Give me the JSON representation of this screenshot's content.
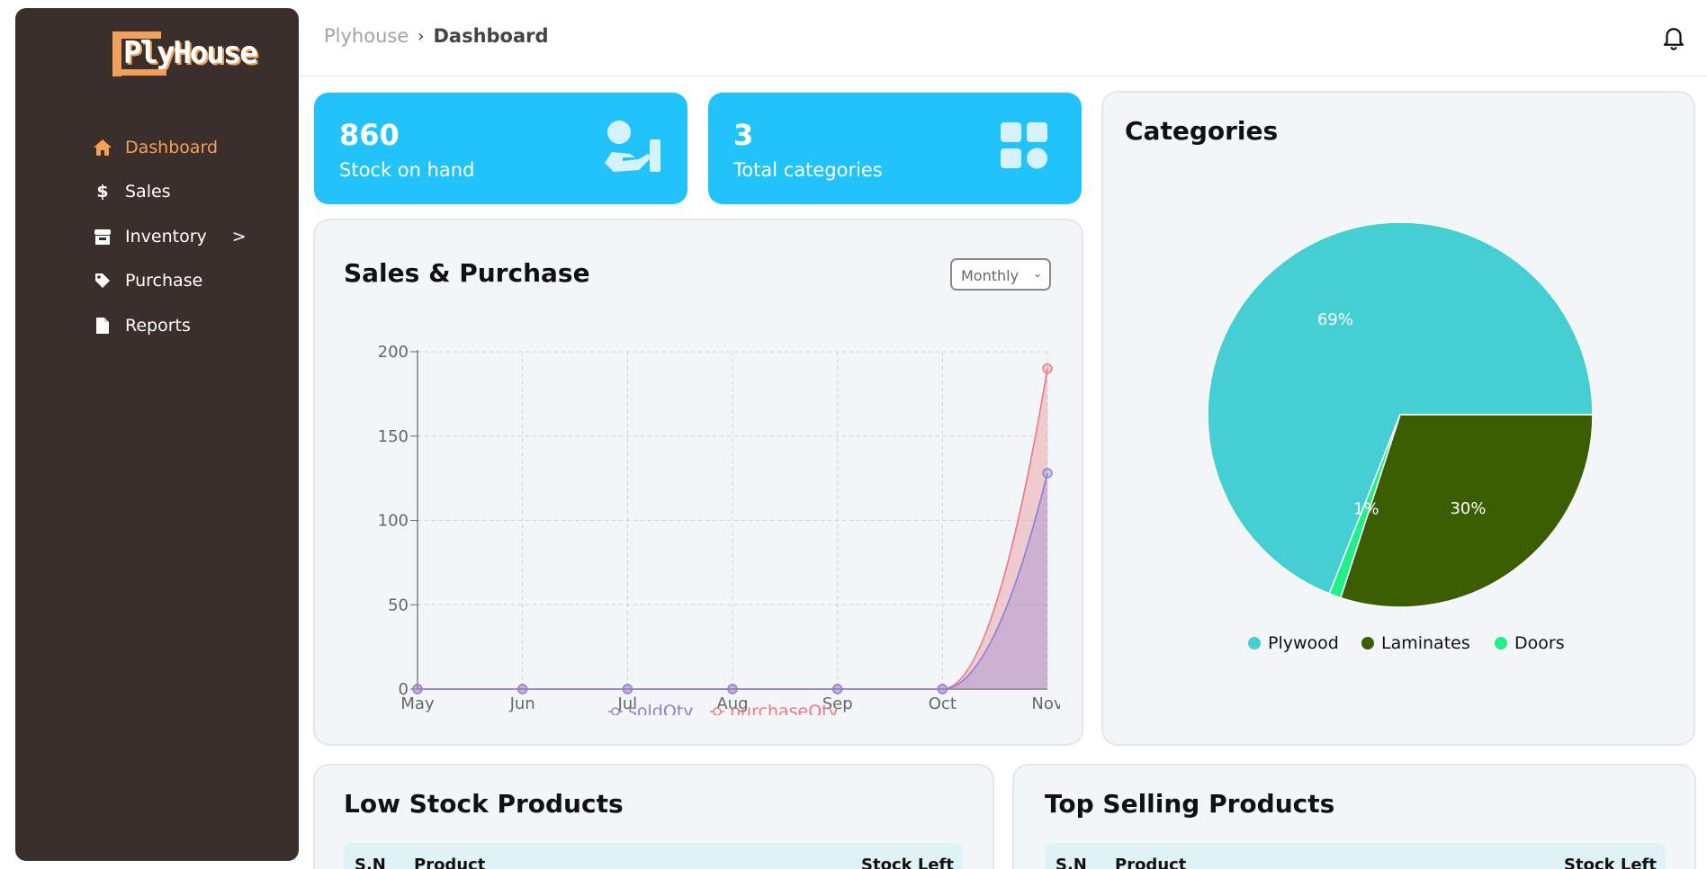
{
  "app": {
    "logo_text": "PlyHouse"
  },
  "sidebar": {
    "items": [
      {
        "label": "Dashboard",
        "icon": "home-icon",
        "active": true
      },
      {
        "label": "Sales",
        "icon": "dollar-icon",
        "active": false
      },
      {
        "label": "Inventory",
        "icon": "store-icon",
        "active": false,
        "arrow": ">"
      },
      {
        "label": "Purchase",
        "icon": "tag-icon",
        "active": false
      },
      {
        "label": "Reports",
        "icon": "file-icon",
        "active": false
      }
    ]
  },
  "header": {
    "breadcrumb_root": "Plyhouse",
    "breadcrumb_sep": "›",
    "breadcrumb_current": "Dashboard"
  },
  "stats": [
    {
      "value": "860",
      "label": "Stock on hand",
      "icon": "stock-hand-icon"
    },
    {
      "value": "3",
      "label": "Total categories",
      "icon": "categories-grid-icon"
    }
  ],
  "sales_panel": {
    "title": "Sales & Purchase",
    "period_select": "Monthly"
  },
  "categories_panel": {
    "title": "Categories"
  },
  "low_stock": {
    "title": "Low Stock Products",
    "columns": [
      "S.N",
      "Product",
      "Stock Left"
    ]
  },
  "top_selling": {
    "title": "Top Selling Products",
    "columns": [
      "S.N",
      "Product",
      "Stock Left"
    ]
  },
  "colors": {
    "sidebar_bg": "#3a2f2d",
    "accent": "#f5a05a",
    "stat_card": "#22c2fb",
    "sold": "#8b80d4",
    "purchase": "#ea7a83",
    "plywood": "#45cfd2",
    "laminates": "#3b5e03",
    "doors": "#22ee8a"
  },
  "chart_data": [
    {
      "type": "area",
      "categories": [
        "May",
        "Jun",
        "Jul",
        "Aug",
        "Sep",
        "Oct",
        "Nov"
      ],
      "series": [
        {
          "name": "soldQty",
          "values": [
            0,
            0,
            0,
            0,
            0,
            0,
            128
          ]
        },
        {
          "name": "purchaseQty",
          "values": [
            0,
            0,
            0,
            0,
            0,
            0,
            190
          ]
        }
      ],
      "ylim": [
        0,
        200
      ],
      "yticks": [
        0,
        50,
        100,
        150,
        200
      ],
      "grid": true,
      "legend": "bottom"
    },
    {
      "type": "pie",
      "labels": [
        "Plywood",
        "Laminates",
        "Doors"
      ],
      "values": [
        69,
        30,
        1
      ],
      "data_labels": [
        "69%",
        "30%",
        "1%"
      ],
      "legend": "bottom"
    }
  ]
}
